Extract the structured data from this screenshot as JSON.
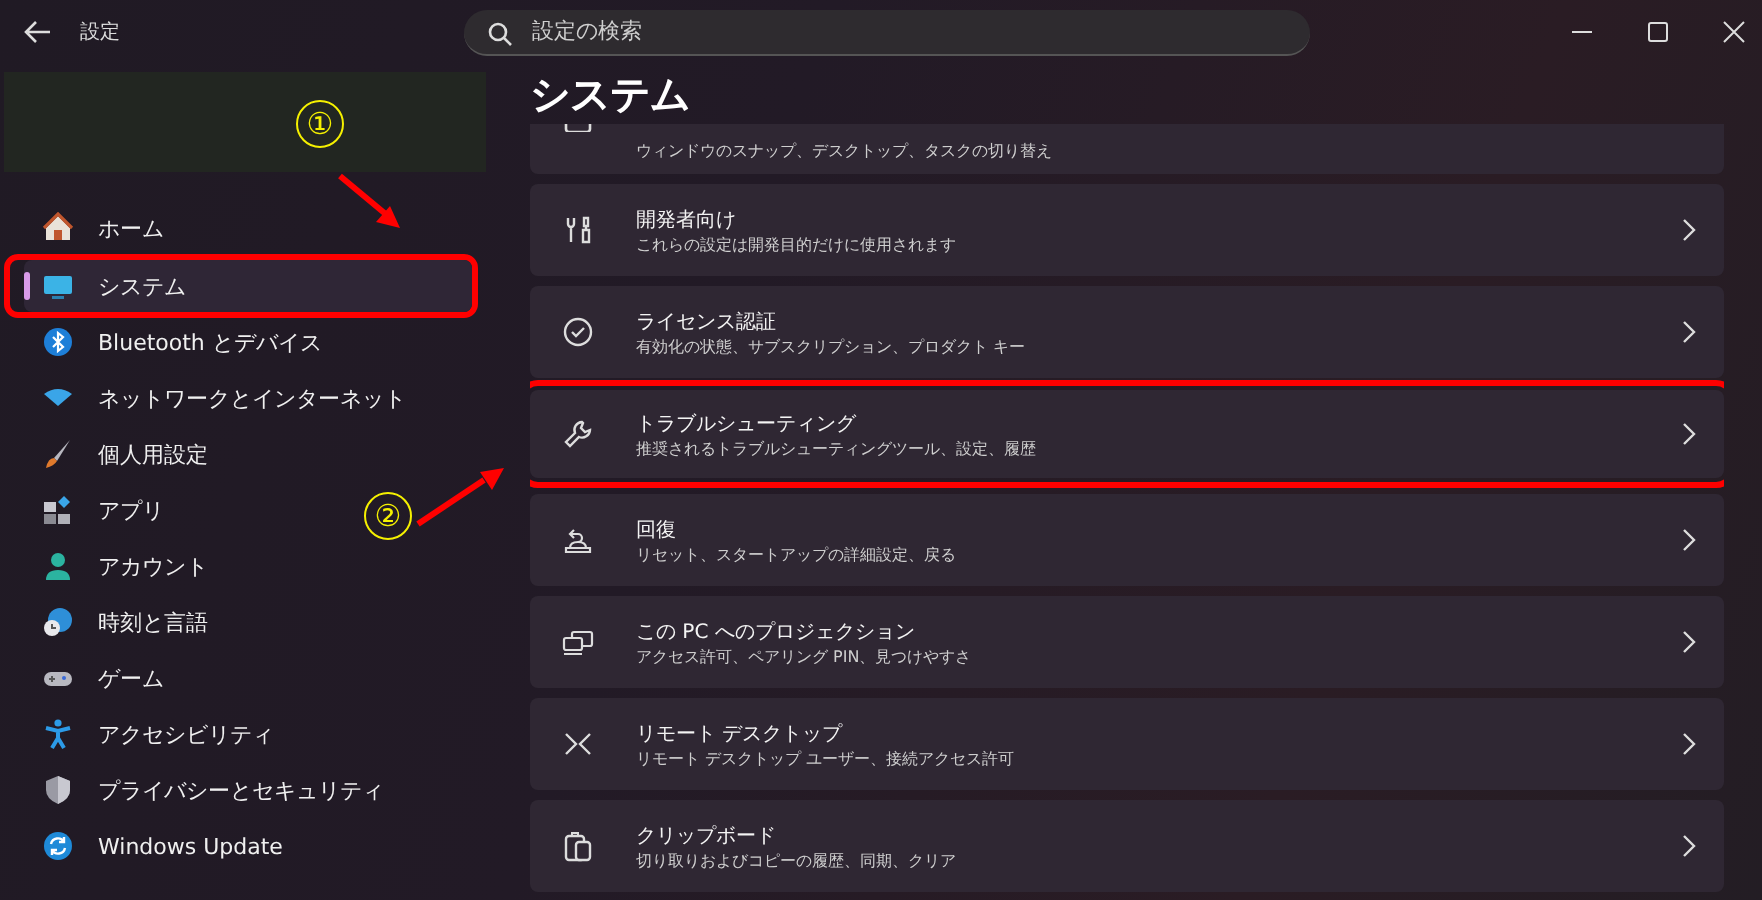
{
  "window": {
    "title": "設定"
  },
  "search": {
    "placeholder": "設定の検索"
  },
  "sidebar": {
    "items": [
      {
        "label": "ホーム",
        "selected": false,
        "highlighted": false
      },
      {
        "label": "システム",
        "selected": true,
        "highlighted": true
      },
      {
        "label": "Bluetooth とデバイス",
        "selected": false,
        "highlighted": false
      },
      {
        "label": "ネットワークとインターネット",
        "selected": false,
        "highlighted": false
      },
      {
        "label": "個人用設定",
        "selected": false,
        "highlighted": false
      },
      {
        "label": "アプリ",
        "selected": false,
        "highlighted": false
      },
      {
        "label": "アカウント",
        "selected": false,
        "highlighted": false
      },
      {
        "label": "時刻と言語",
        "selected": false,
        "highlighted": false
      },
      {
        "label": "ゲーム",
        "selected": false,
        "highlighted": false
      },
      {
        "label": "アクセシビリティ",
        "selected": false,
        "highlighted": false
      },
      {
        "label": "プライバシーとセキュリティ",
        "selected": false,
        "highlighted": false
      },
      {
        "label": "Windows Update",
        "selected": false,
        "highlighted": false
      }
    ]
  },
  "page": {
    "title": "システム",
    "cards": [
      {
        "kind": "partial",
        "subtitle": "ウィンドウのスナップ、デスクトップ、タスクの切り替え",
        "highlighted": false
      },
      {
        "kind": "full",
        "title": "開発者向け",
        "subtitle": "これらの設定は開発目的だけに使用されます",
        "highlighted": false
      },
      {
        "kind": "full",
        "title": "ライセンス認証",
        "subtitle": "有効化の状態、サブスクリプション、プロダクト キー",
        "highlighted": false
      },
      {
        "kind": "full",
        "title": "トラブルシューティング",
        "subtitle": "推奨されるトラブルシューティングツール、設定、履歴",
        "highlighted": true
      },
      {
        "kind": "full",
        "title": "回復",
        "subtitle": "リセット、スタートアップの詳細設定、戻る",
        "highlighted": false
      },
      {
        "kind": "full",
        "title": "この PC へのプロジェクション",
        "subtitle": "アクセス許可、ペアリング PIN、見つけやすさ",
        "highlighted": false
      },
      {
        "kind": "full",
        "title": "リモート デスクトップ",
        "subtitle": "リモート デスクトップ ユーザー、接続アクセス許可",
        "highlighted": false
      },
      {
        "kind": "full",
        "title": "クリップボード",
        "subtitle": "切り取りおよびコピーの履歴、同期、クリア",
        "highlighted": false
      }
    ]
  },
  "annotations": [
    {
      "label": "①"
    },
    {
      "label": "②"
    }
  ]
}
